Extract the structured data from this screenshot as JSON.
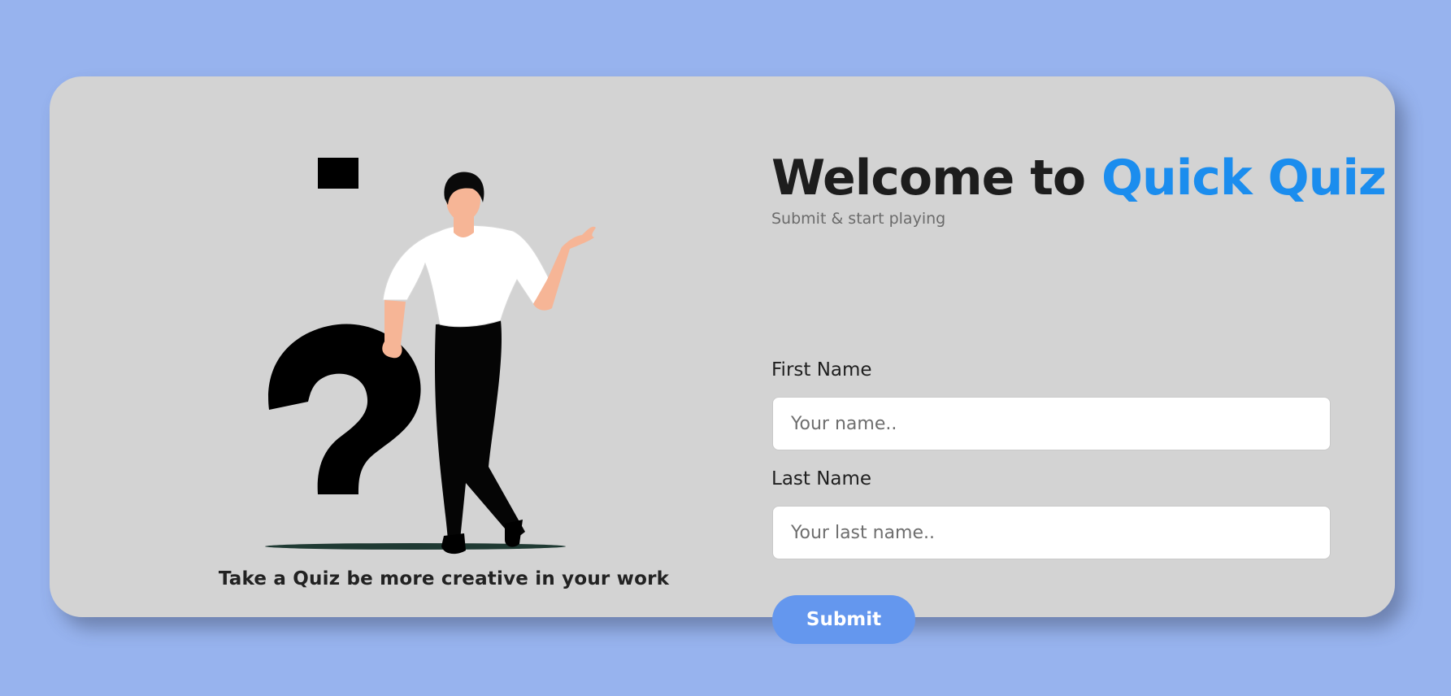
{
  "illustration": {
    "tagline": "Take a Quiz be more creative in your work",
    "figure": "man-leaning-on-question-mark"
  },
  "header": {
    "title_prefix": "Welcome to ",
    "title_accent": "Quick Quiz",
    "subtitle": "Submit & start playing"
  },
  "form": {
    "first_name_label": "First Name",
    "first_name_placeholder": "Your name..",
    "last_name_label": "Last Name",
    "last_name_placeholder": "Your last name..",
    "submit_label": "Submit"
  },
  "colors": {
    "background": "#97b3ee",
    "card": "#d3d3d3",
    "accent": "#1b8dee",
    "button": "#6497ee"
  }
}
